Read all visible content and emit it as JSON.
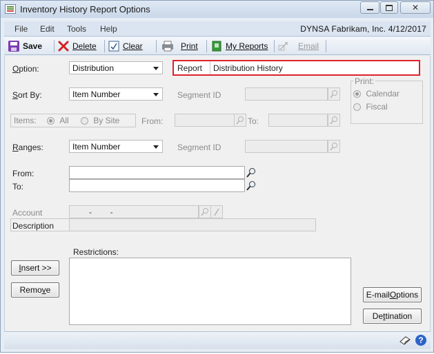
{
  "window": {
    "title": "Inventory History Report Options",
    "controls": {
      "minimize": "▭",
      "maximize": "□",
      "close": "✕"
    }
  },
  "menu": {
    "items": [
      "File",
      "Edit",
      "Tools",
      "Help"
    ],
    "company": "DYNSA  Fabrikam, Inc.  4/12/2017"
  },
  "toolbar": {
    "save": "Save",
    "delete": "Delete",
    "clear": "Clear",
    "print": "Print",
    "my_reports": "My Reports",
    "email": "Email"
  },
  "form": {
    "option_label": "Option:",
    "option_value": "Distribution",
    "report_label": "Report",
    "report_value": "Distribution History",
    "sort_by_label": "Sort By:",
    "sort_by_value": "Item Number",
    "segment_id_label": "Segment ID",
    "items_label": "Items:",
    "items_all": "All",
    "items_by_site": "By Site",
    "from_label_top": "From:",
    "to_label_top": "To:",
    "ranges_label": "Ranges:",
    "ranges_value": "Item Number",
    "segment_id_label_2": "Segment ID",
    "from_label": "From:",
    "to_label": "To:",
    "account_label": "Account",
    "account_value": "-        -",
    "description_label": "Description",
    "restrictions_label": "Restrictions:",
    "print_group_label": "Print:",
    "print_calendar": "Calendar",
    "print_fiscal": "Fiscal"
  },
  "buttons": {
    "insert": "Insert >>",
    "remove": "Remove",
    "email_options": "E-mail Options",
    "destination": "Destination"
  },
  "colors": {
    "highlight": "#e0202a",
    "save_icon": "#7b3fb0",
    "delete_icon": "#d42020",
    "reports_icon": "#3a9a3a"
  }
}
